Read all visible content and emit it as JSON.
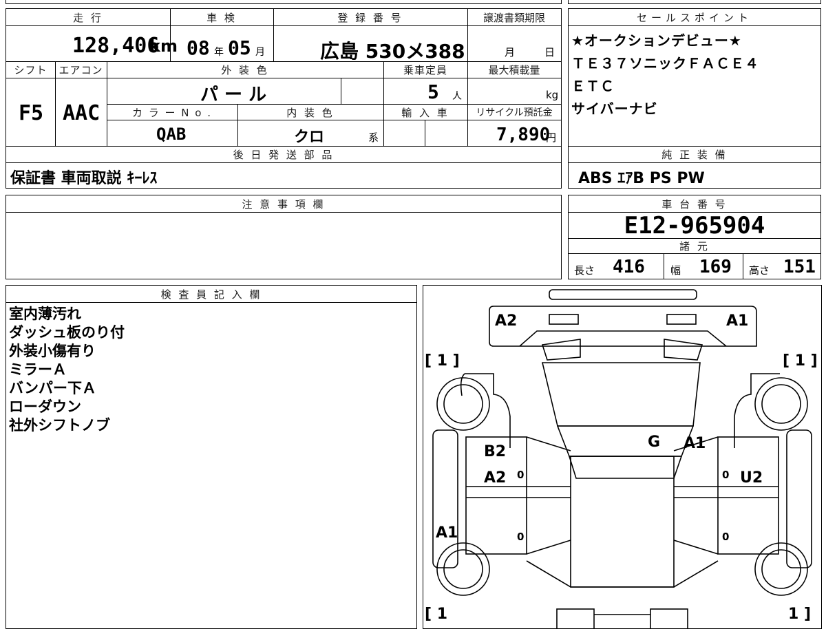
{
  "header": {
    "mileage_label": "走 行",
    "inspection_label": "車 検",
    "registration_label": "登 録 番 号",
    "transfer_label": "譲渡書類期限",
    "mileage_value": "128,406",
    "mileage_unit": "km",
    "inspection_year": "08",
    "inspection_year_unit": "年",
    "inspection_month": "05",
    "inspection_month_unit": "月",
    "registration_value": "広島 530メ388",
    "transfer_month_unit": "月",
    "transfer_day_unit": "日"
  },
  "specs": {
    "shift_label": "シフト",
    "aircon_label": "エアコン",
    "exterior_color_label": "外 装 色",
    "capacity_label": "乗車定員",
    "max_load_label": "最大積載量",
    "shift_value": "F5",
    "aircon_value": "AAC",
    "exterior_color_value": "パ ー ル",
    "capacity_value": "5",
    "capacity_unit": "人",
    "max_load_unit": "kg",
    "color_no_label": "カ ラ ー N o .",
    "interior_color_label": "内 装 色",
    "import_label": "輸 入 車",
    "recycle_label": "リサイクル預託金",
    "color_no_value": "QAB",
    "interior_color_value": "クロ",
    "interior_color_suffix": "系",
    "recycle_value": "7,890",
    "recycle_unit": "円"
  },
  "later_parts": {
    "label": "後 日 発 送 部 品",
    "value": "保証書 車両取説 ｷｰﾚｽ"
  },
  "sales_points": {
    "label": "セールスポイント",
    "lines": [
      "★オークションデビュー★",
      "ＴＥ３７ソニックＦＡＣＥ４",
      "ＥＴＣ",
      "サイバーナビ"
    ]
  },
  "equipment": {
    "label": "純 正 装 備",
    "value": "ABS ｴｱB PS PW"
  },
  "notes": {
    "label": "注 意 事 項 欄"
  },
  "chassis": {
    "label": "車 台 番 号",
    "value": "E12-965904",
    "specs_label": "諸 元",
    "length_label": "長さ",
    "length_value": "416",
    "width_label": "幅",
    "width_value": "169",
    "height_label": "高さ",
    "height_value": "151"
  },
  "inspector": {
    "label": "検 査 員 記 入 欄",
    "lines": [
      "室内薄汚れ",
      "ダッシュ板のり付",
      "外装小傷有り",
      "ミラーＡ",
      "バンパー下Ａ",
      "ローダウン",
      "社外シフトノブ"
    ]
  },
  "diagram": {
    "marks": {
      "front_left": "A2",
      "front_right": "A1",
      "tire_fl": "[ 1 ]",
      "tire_fr": "[ 1 ]",
      "tire_rl": "[ 1",
      "tire_rr": "1 ]",
      "door_left_upper": "B2",
      "door_left_lower": "A2",
      "rocker_left": "A1",
      "roof": "G",
      "roof_right": "A1",
      "door_right": "U2",
      "zero": "0"
    }
  }
}
